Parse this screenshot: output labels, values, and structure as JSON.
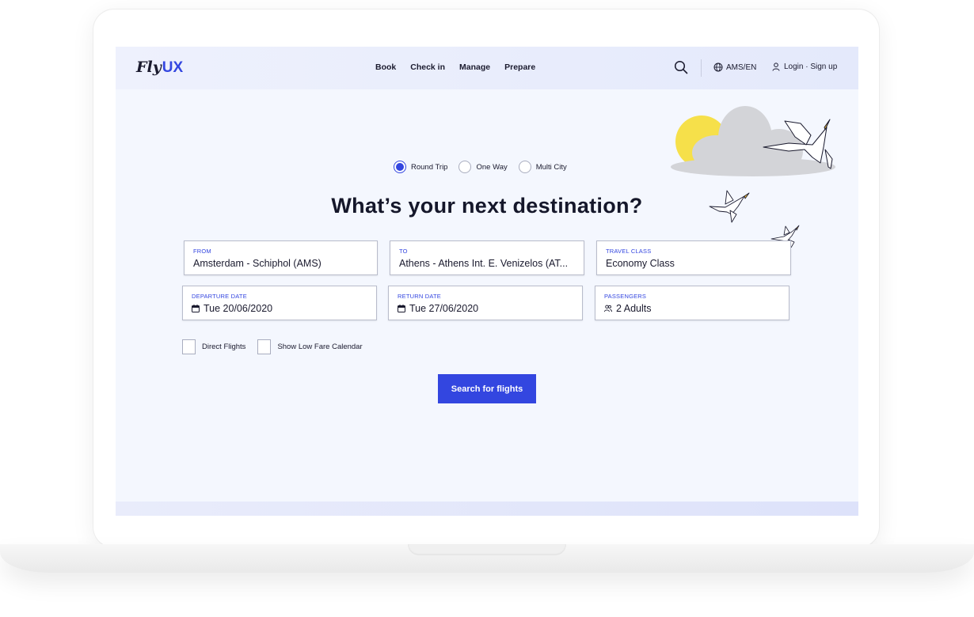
{
  "brand": {
    "logo_fly": "Fly",
    "logo_ux": "UX"
  },
  "nav": {
    "links": [
      "Book",
      "Check in",
      "Manage",
      "Prepare"
    ],
    "locale": "AMS/EN",
    "login": "Login · Sign up"
  },
  "search": {
    "trip_types": [
      "Round Trip",
      "One Way",
      "Multi City"
    ],
    "trip_type_selected": "Round Trip",
    "headline": "What’s your next destination?",
    "fields": {
      "from": {
        "label": "FROM",
        "value": "Amsterdam - Schiphol (AMS)"
      },
      "to": {
        "label": "TO",
        "value": "Athens - Athens Int. E. Venizelos (AT..."
      },
      "travel_class": {
        "label": "TRAVEL CLASS",
        "value": "Economy Class"
      },
      "departure_date": {
        "label": "DEPARTURE DATE",
        "value": "Tue 20/06/2020"
      },
      "return_date": {
        "label": "RETURN DATE",
        "value": "Tue 27/06/2020"
      },
      "passengers": {
        "label": "PASSENGERS",
        "value": "2 Adults"
      }
    },
    "options": [
      "Direct Flights",
      "Show Low Fare Calendar"
    ],
    "submit_label": "Search for flights"
  },
  "icons": {
    "search": "search-icon",
    "locale": "globe-icon",
    "login": "user-icon",
    "date": "calendar-icon",
    "passengers": "people-icon"
  },
  "colors": {
    "accent": "#3346e0",
    "text": "#1a1a2e",
    "background": "#f4f7fe",
    "sun": "#f6e04a",
    "cloud": "#d3d4d8"
  }
}
